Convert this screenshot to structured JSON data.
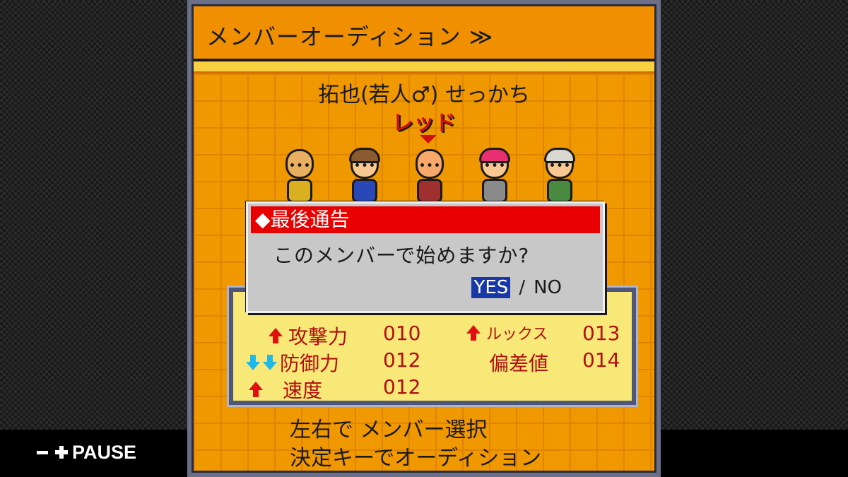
{
  "overlay": {
    "pause_label": "PAUSE"
  },
  "screen": {
    "title": "メンバーオーディション ≫",
    "member": {
      "name": "拓也(若人♂) せっかち",
      "color": "レッド"
    },
    "characters": [
      "cat-mask",
      "glasses-boy",
      "red-bald",
      "pink-girl",
      "grandma"
    ],
    "stats": {
      "rows": [
        {
          "arrow": "up",
          "label": "攻撃力",
          "value": "010"
        },
        {
          "arrow": "down2",
          "label": "防御力",
          "value": "012"
        },
        {
          "arrow": "up",
          "label": "速度",
          "value": "012"
        },
        {
          "arrow": "up",
          "label": "ルックス",
          "value": "013"
        },
        {
          "arrow": "none",
          "label": "偏差値",
          "value": "014"
        }
      ]
    },
    "dialog": {
      "title": "◆最後通告",
      "message": "このメンバーで始めますか?",
      "yes": "YES",
      "sep": "/",
      "no": "NO"
    },
    "help": [
      "左右で メンバー選択",
      "決定キーでオーディション"
    ]
  },
  "colors": {
    "accent_red": "#e80000",
    "panel_orange": "#f09000",
    "stats_yellow": "#f8e878",
    "yes_blue": "#1838a8"
  }
}
